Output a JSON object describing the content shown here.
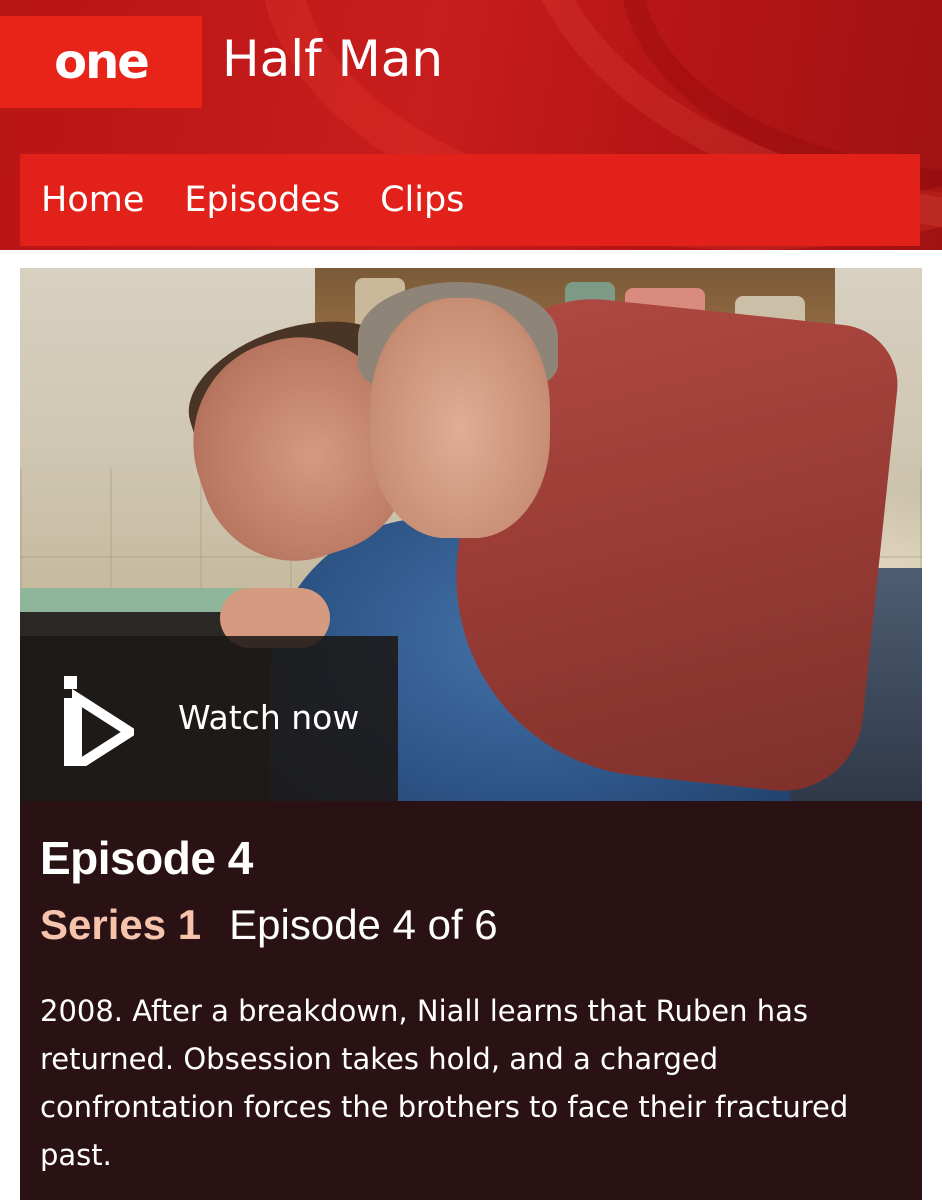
{
  "header": {
    "channel_logo": "one",
    "show_title": "Half Man"
  },
  "nav": {
    "items": [
      {
        "label": "Home"
      },
      {
        "label": "Episodes"
      },
      {
        "label": "Clips"
      }
    ]
  },
  "hero": {
    "watch_label": "Watch now",
    "icon": "iplayer-play-icon"
  },
  "episode": {
    "title": "Episode 4",
    "series": "Series 1",
    "episode_count": "Episode 4 of 6",
    "synopsis": "2008. After a breakdown, Niall learns that Ruben has returned. Obsession takes hold, and a charged confrontation forces the brothers to face their fractured past."
  },
  "colors": {
    "brand_red": "#e82418",
    "nav_red": "#e2211a",
    "info_bg": "#2a1214",
    "series_accent": "#f6c4ad"
  }
}
